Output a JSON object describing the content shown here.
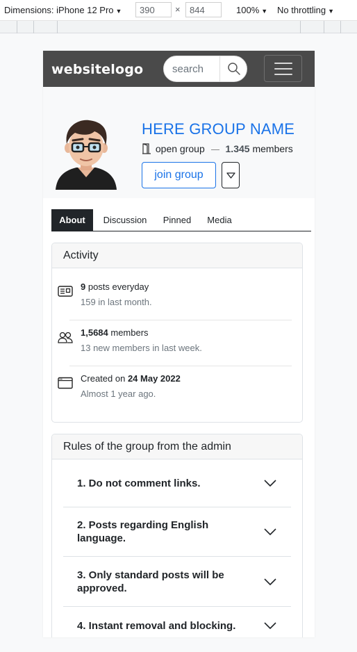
{
  "devtools": {
    "dimensions_label": "Dimensions: iPhone 12 Pro",
    "width": "390",
    "height": "844",
    "times": "×",
    "zoom": "100%",
    "throttling": "No throttling"
  },
  "navbar": {
    "logo": "websitelogo",
    "search_placeholder": "search"
  },
  "group": {
    "name": "HERE GROUP NAME",
    "type": "open group",
    "member_count": "1.345",
    "members_word": "members",
    "join_label": "join group"
  },
  "tabs": [
    {
      "label": "About",
      "active": true
    },
    {
      "label": "Discussion",
      "active": false
    },
    {
      "label": "Pinned",
      "active": false
    },
    {
      "label": "Media",
      "active": false
    }
  ],
  "activity": {
    "title": "Activity",
    "rows": [
      {
        "icon": "newspaper-icon",
        "strong": "9",
        "line1_rest": " posts everyday",
        "line2": "159 in last month."
      },
      {
        "icon": "people-icon",
        "strong": "1,5684",
        "line1_rest": " members",
        "line2": "13 new members in last week."
      },
      {
        "icon": "window-icon",
        "line1_prefix": "Created on ",
        "strong": "24 May 2022",
        "line2": "Almost 1 year ago."
      }
    ]
  },
  "rules": {
    "title": "Rules of the group from the admin",
    "items": [
      "1. Do not comment links.",
      "2. Posts regarding English language.",
      "3. Only standard posts will be approved.",
      "4. Instant removal and blocking."
    ]
  },
  "colors": {
    "navbar": "#4a4a4a",
    "accent": "#1a73e8",
    "dark": "#212529"
  }
}
